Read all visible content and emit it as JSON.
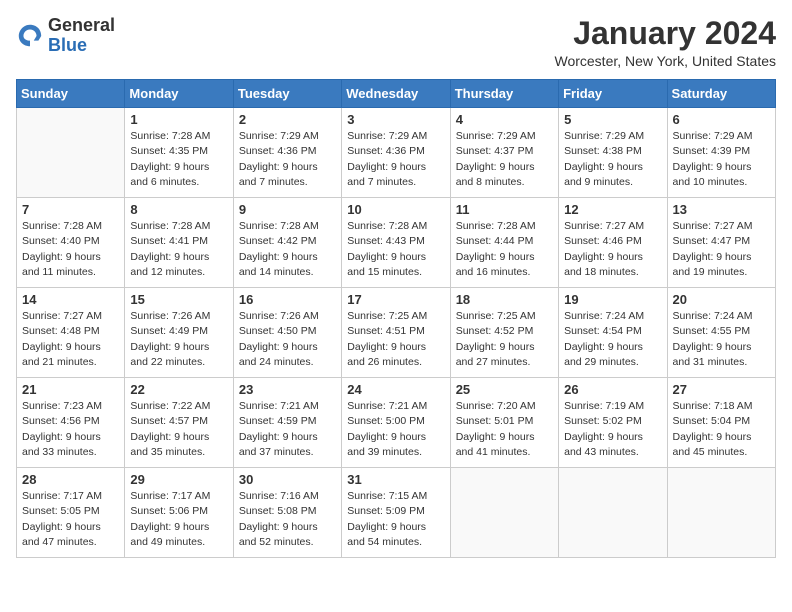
{
  "logo": {
    "general": "General",
    "blue": "Blue"
  },
  "title": "January 2024",
  "location": "Worcester, New York, United States",
  "days_of_week": [
    "Sunday",
    "Monday",
    "Tuesday",
    "Wednesday",
    "Thursday",
    "Friday",
    "Saturday"
  ],
  "weeks": [
    [
      {
        "day": "",
        "sunrise": "",
        "sunset": "",
        "daylight": ""
      },
      {
        "day": "1",
        "sunrise": "Sunrise: 7:28 AM",
        "sunset": "Sunset: 4:35 PM",
        "daylight": "Daylight: 9 hours and 6 minutes."
      },
      {
        "day": "2",
        "sunrise": "Sunrise: 7:29 AM",
        "sunset": "Sunset: 4:36 PM",
        "daylight": "Daylight: 9 hours and 7 minutes."
      },
      {
        "day": "3",
        "sunrise": "Sunrise: 7:29 AM",
        "sunset": "Sunset: 4:36 PM",
        "daylight": "Daylight: 9 hours and 7 minutes."
      },
      {
        "day": "4",
        "sunrise": "Sunrise: 7:29 AM",
        "sunset": "Sunset: 4:37 PM",
        "daylight": "Daylight: 9 hours and 8 minutes."
      },
      {
        "day": "5",
        "sunrise": "Sunrise: 7:29 AM",
        "sunset": "Sunset: 4:38 PM",
        "daylight": "Daylight: 9 hours and 9 minutes."
      },
      {
        "day": "6",
        "sunrise": "Sunrise: 7:29 AM",
        "sunset": "Sunset: 4:39 PM",
        "daylight": "Daylight: 9 hours and 10 minutes."
      }
    ],
    [
      {
        "day": "7",
        "sunrise": "Sunrise: 7:28 AM",
        "sunset": "Sunset: 4:40 PM",
        "daylight": "Daylight: 9 hours and 11 minutes."
      },
      {
        "day": "8",
        "sunrise": "Sunrise: 7:28 AM",
        "sunset": "Sunset: 4:41 PM",
        "daylight": "Daylight: 9 hours and 12 minutes."
      },
      {
        "day": "9",
        "sunrise": "Sunrise: 7:28 AM",
        "sunset": "Sunset: 4:42 PM",
        "daylight": "Daylight: 9 hours and 14 minutes."
      },
      {
        "day": "10",
        "sunrise": "Sunrise: 7:28 AM",
        "sunset": "Sunset: 4:43 PM",
        "daylight": "Daylight: 9 hours and 15 minutes."
      },
      {
        "day": "11",
        "sunrise": "Sunrise: 7:28 AM",
        "sunset": "Sunset: 4:44 PM",
        "daylight": "Daylight: 9 hours and 16 minutes."
      },
      {
        "day": "12",
        "sunrise": "Sunrise: 7:27 AM",
        "sunset": "Sunset: 4:46 PM",
        "daylight": "Daylight: 9 hours and 18 minutes."
      },
      {
        "day": "13",
        "sunrise": "Sunrise: 7:27 AM",
        "sunset": "Sunset: 4:47 PM",
        "daylight": "Daylight: 9 hours and 19 minutes."
      }
    ],
    [
      {
        "day": "14",
        "sunrise": "Sunrise: 7:27 AM",
        "sunset": "Sunset: 4:48 PM",
        "daylight": "Daylight: 9 hours and 21 minutes."
      },
      {
        "day": "15",
        "sunrise": "Sunrise: 7:26 AM",
        "sunset": "Sunset: 4:49 PM",
        "daylight": "Daylight: 9 hours and 22 minutes."
      },
      {
        "day": "16",
        "sunrise": "Sunrise: 7:26 AM",
        "sunset": "Sunset: 4:50 PM",
        "daylight": "Daylight: 9 hours and 24 minutes."
      },
      {
        "day": "17",
        "sunrise": "Sunrise: 7:25 AM",
        "sunset": "Sunset: 4:51 PM",
        "daylight": "Daylight: 9 hours and 26 minutes."
      },
      {
        "day": "18",
        "sunrise": "Sunrise: 7:25 AM",
        "sunset": "Sunset: 4:52 PM",
        "daylight": "Daylight: 9 hours and 27 minutes."
      },
      {
        "day": "19",
        "sunrise": "Sunrise: 7:24 AM",
        "sunset": "Sunset: 4:54 PM",
        "daylight": "Daylight: 9 hours and 29 minutes."
      },
      {
        "day": "20",
        "sunrise": "Sunrise: 7:24 AM",
        "sunset": "Sunset: 4:55 PM",
        "daylight": "Daylight: 9 hours and 31 minutes."
      }
    ],
    [
      {
        "day": "21",
        "sunrise": "Sunrise: 7:23 AM",
        "sunset": "Sunset: 4:56 PM",
        "daylight": "Daylight: 9 hours and 33 minutes."
      },
      {
        "day": "22",
        "sunrise": "Sunrise: 7:22 AM",
        "sunset": "Sunset: 4:57 PM",
        "daylight": "Daylight: 9 hours and 35 minutes."
      },
      {
        "day": "23",
        "sunrise": "Sunrise: 7:21 AM",
        "sunset": "Sunset: 4:59 PM",
        "daylight": "Daylight: 9 hours and 37 minutes."
      },
      {
        "day": "24",
        "sunrise": "Sunrise: 7:21 AM",
        "sunset": "Sunset: 5:00 PM",
        "daylight": "Daylight: 9 hours and 39 minutes."
      },
      {
        "day": "25",
        "sunrise": "Sunrise: 7:20 AM",
        "sunset": "Sunset: 5:01 PM",
        "daylight": "Daylight: 9 hours and 41 minutes."
      },
      {
        "day": "26",
        "sunrise": "Sunrise: 7:19 AM",
        "sunset": "Sunset: 5:02 PM",
        "daylight": "Daylight: 9 hours and 43 minutes."
      },
      {
        "day": "27",
        "sunrise": "Sunrise: 7:18 AM",
        "sunset": "Sunset: 5:04 PM",
        "daylight": "Daylight: 9 hours and 45 minutes."
      }
    ],
    [
      {
        "day": "28",
        "sunrise": "Sunrise: 7:17 AM",
        "sunset": "Sunset: 5:05 PM",
        "daylight": "Daylight: 9 hours and 47 minutes."
      },
      {
        "day": "29",
        "sunrise": "Sunrise: 7:17 AM",
        "sunset": "Sunset: 5:06 PM",
        "daylight": "Daylight: 9 hours and 49 minutes."
      },
      {
        "day": "30",
        "sunrise": "Sunrise: 7:16 AM",
        "sunset": "Sunset: 5:08 PM",
        "daylight": "Daylight: 9 hours and 52 minutes."
      },
      {
        "day": "31",
        "sunrise": "Sunrise: 7:15 AM",
        "sunset": "Sunset: 5:09 PM",
        "daylight": "Daylight: 9 hours and 54 minutes."
      },
      {
        "day": "",
        "sunrise": "",
        "sunset": "",
        "daylight": ""
      },
      {
        "day": "",
        "sunrise": "",
        "sunset": "",
        "daylight": ""
      },
      {
        "day": "",
        "sunrise": "",
        "sunset": "",
        "daylight": ""
      }
    ]
  ]
}
